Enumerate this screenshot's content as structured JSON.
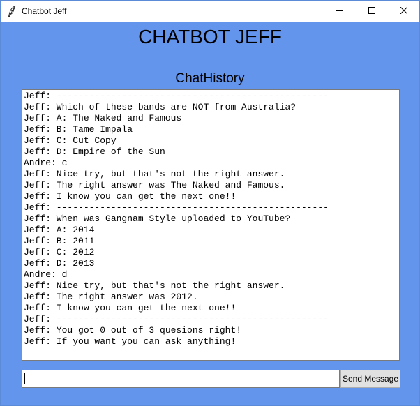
{
  "window": {
    "title": "Chatbot Jeff",
    "icon": "feather-icon",
    "controls": {
      "minimize_icon": "minimize-icon",
      "maximize_icon": "maximize-icon",
      "close_icon": "close-icon"
    },
    "background_color": "#6495ed"
  },
  "main": {
    "heading": "CHATBOT JEFF",
    "subheading": "ChatHistory"
  },
  "chat_history": {
    "lines": [
      "Jeff: --------------------------------------------------",
      "Jeff: Which of these bands are NOT from Australia?",
      "Jeff: A: The Naked and Famous",
      "Jeff: B: Tame Impala",
      "Jeff: C: Cut Copy",
      "Jeff: D: Empire of the Sun",
      "Andre: c",
      "Jeff: Nice try, but that's not the right answer.",
      "Jeff: The right answer was The Naked and Famous.",
      "Jeff: I know you can get the next one!!",
      "Jeff: --------------------------------------------------",
      "Jeff: When was Gangnam Style uploaded to YouTube?",
      "Jeff: A: 2014",
      "Jeff: B: 2011",
      "Jeff: C: 2012",
      "Jeff: D: 2013",
      "Andre: d",
      "Jeff: Nice try, but that's not the right answer.",
      "Jeff: The right answer was 2012.",
      "Jeff: I know you can get the next one!!",
      "Jeff: --------------------------------------------------",
      "Jeff: You got 0 out of 3 quesions right!",
      "Jeff: If you want you can ask anything!"
    ]
  },
  "input": {
    "value": ""
  },
  "send_button": {
    "label": "Send Message"
  }
}
